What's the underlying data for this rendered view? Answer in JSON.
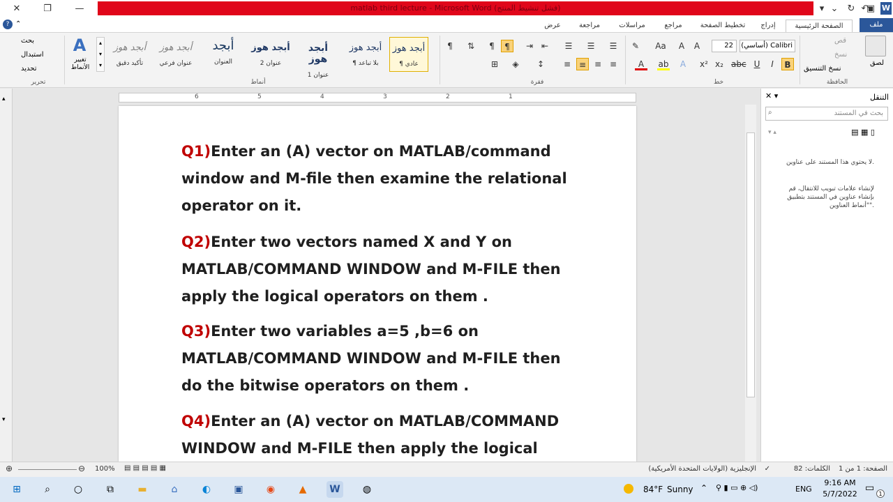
{
  "titlebar": {
    "title": "matlab third lecture  -  Microsoft Word  (فشل تنشيط المنتج)"
  },
  "tabs": [
    "ملف",
    "الصفحة الرئيسية",
    "إدراج",
    "تخطيط الصفحة",
    "مراجع",
    "مراسلات",
    "مراجعة",
    "عرض"
  ],
  "ribbon": {
    "clipboard": {
      "paste": "لصق",
      "cut": "قص",
      "copy": "نسخ",
      "format_painter": "نسخ التنسيق",
      "label": "الحافظة"
    },
    "font": {
      "name": "(أساسي) Calibri",
      "size": "22",
      "label": "خط"
    },
    "paragraph": {
      "label": "فقرة"
    },
    "styles": {
      "label": "أنماط",
      "items": [
        {
          "preview": "أبجد هوز",
          "name": "¶ عادي"
        },
        {
          "preview": "أبجد هوز",
          "name": "¶ بلا تباعد"
        },
        {
          "preview": "أبجد هوز",
          "name": "عنوان 1"
        },
        {
          "preview": "أبجد هوز",
          "name": "عنوان 2"
        },
        {
          "preview": "أبجد",
          "name": "العنوان"
        },
        {
          "preview": "أبجد هوز",
          "name": "عنوان فرعي"
        },
        {
          "preview": "أبجد هوز",
          "name": "تأكيد دقيق"
        }
      ],
      "change_styles": "تغيير الأنماط"
    },
    "editing": {
      "find": "بحث",
      "replace": "استبدال",
      "select": "تحديد",
      "label": "تحرير"
    }
  },
  "ruler": {
    "ticks": [
      "6",
      "5",
      "4",
      "3",
      "2",
      "1"
    ]
  },
  "document": {
    "questions": [
      {
        "num": "Q1)",
        "text": "Enter an (A) vector on MATLAB/command window and M-file  then examine the relational operator on it."
      },
      {
        "num": "Q2)",
        "text": "Enter two vectors named X and Y on MATLAB/COMMAND  WINDOW and M-FILE then apply the logical operators on them ."
      },
      {
        "num": "Q3)",
        "text": "Enter two variables a=5 ,b=6 on MATLAB/COMMAND  WINDOW and M-FILE then do the bitwise operators on them ."
      },
      {
        "num": "Q4)",
        "text": "Enter an (A) vector on MATLAB/COMMAND WINDOW and M-FILE then apply the logical"
      }
    ]
  },
  "navpane": {
    "title": "التنقل",
    "search_placeholder": "بحث في المستند",
    "msg1": "لا يحتوي هذا المستند على عناوين.",
    "msg2": "لإنشاء علامات تبويب للانتقال، قم بإنشاء عناوين في المستند بتطبيق \"أنماط العناوين\"."
  },
  "status": {
    "page": "الصفحة: 1 من 1",
    "words": "الكلمات: 82",
    "language": "الإنجليزية (الولايات المتحدة الأمريكية)",
    "zoom": "100%"
  },
  "taskbar": {
    "weather_temp": "84°F",
    "weather_text": "Sunny",
    "lang": "ENG",
    "time": "9:16 AM",
    "date": "5/7/2022",
    "notif_count": "1"
  }
}
